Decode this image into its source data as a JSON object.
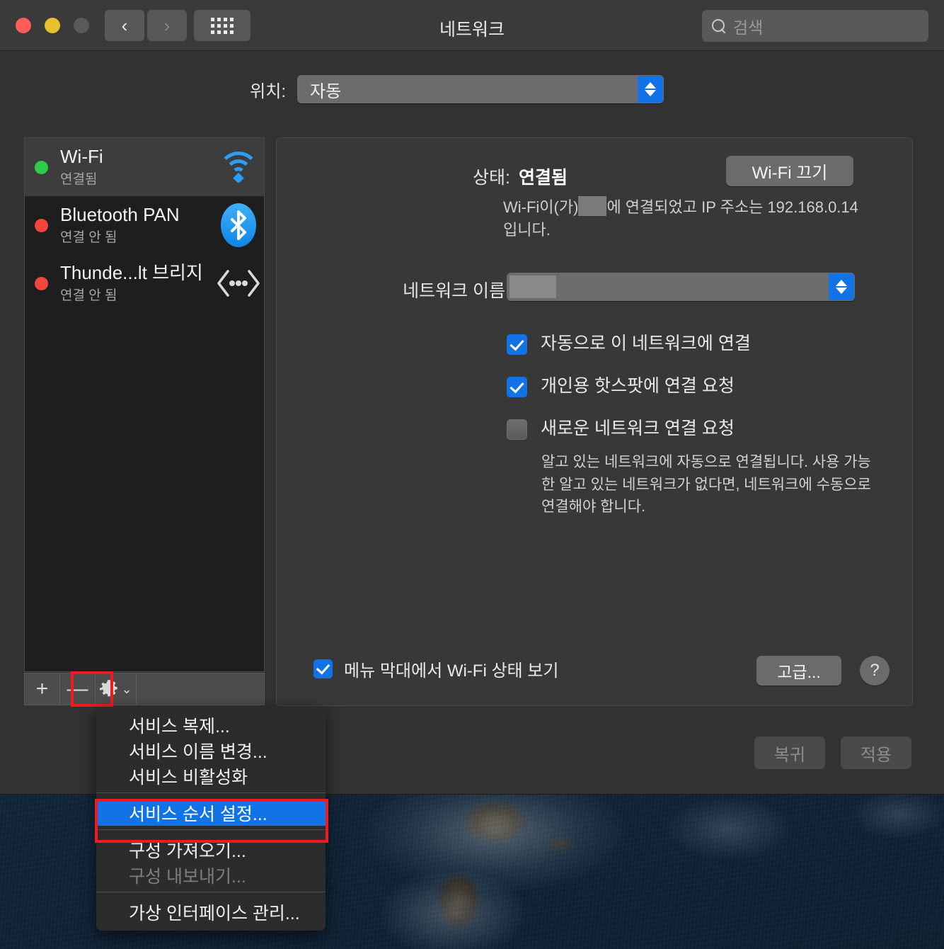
{
  "window": {
    "title": "네트워크",
    "traffic_lights": [
      "close",
      "minimize",
      "zoom"
    ],
    "nav": {
      "back": "‹",
      "forward": "›",
      "grid": "grid-view-icon"
    },
    "search": {
      "placeholder": "검색",
      "value": ""
    }
  },
  "location": {
    "label": "위치:",
    "value": "자동"
  },
  "services": [
    {
      "name": "Wi-Fi",
      "status": "연결됨",
      "dot": "green",
      "icon": "wifi-icon",
      "selected": true
    },
    {
      "name": "Bluetooth PAN",
      "status": "연결 안 됨",
      "dot": "red",
      "icon": "bluetooth-icon",
      "selected": false
    },
    {
      "name": "Thunde...lt 브리지",
      "status": "연결 안 됨",
      "dot": "red",
      "icon": "thunderbolt-bridge-icon",
      "selected": false
    }
  ],
  "sidebar_toolbar": {
    "add": "+",
    "remove": "—",
    "gear": "gear-icon",
    "gear_chevron": "⌄"
  },
  "detail": {
    "status_label": "상태:",
    "status_value": "연결됨",
    "wifi_toggle_label": "Wi-Fi 끄기",
    "status_desc_part1": "Wi-Fi이(가)",
    "status_desc_part2": "에 연결되었고 IP 주소는 192.168.0.14입니다.",
    "netname_label": "네트워크 이름:",
    "netname_value": "",
    "checkboxes": [
      {
        "label": "자동으로 이 네트워크에 연결",
        "checked": true
      },
      {
        "label": "개인용 핫스팟에 연결 요청",
        "checked": true
      },
      {
        "label": "새로운 네트워크 연결 요청",
        "checked": false
      }
    ],
    "help_text": "알고 있는 네트워크에 자동으로 연결됩니다. 사용 가능한 알고 있는 네트워크가 없다면, 네트워크에 수동으로 연결해야 합니다.",
    "menubar_checkbox": {
      "label": "메뉴 막대에서 Wi-Fi 상태 보기",
      "checked": true
    },
    "advanced_label": "고급...",
    "help_label": "?"
  },
  "bottom_actions": [
    {
      "label": "복귀",
      "enabled": false
    },
    {
      "label": "적용",
      "enabled": false
    }
  ],
  "context_menu": [
    {
      "label": "서비스 복제...",
      "state": "normal"
    },
    {
      "label": "서비스 이름 변경...",
      "state": "normal"
    },
    {
      "label": "서비스 비활성화",
      "state": "normal"
    },
    {
      "label": "서비스 순서 설정...",
      "state": "selected"
    },
    {
      "label": "구성 가져오기...",
      "state": "normal"
    },
    {
      "label": "구성 내보내기...",
      "state": "disabled"
    },
    {
      "label": "가상 인터페이스 관리...",
      "state": "normal"
    }
  ],
  "colors": {
    "accent_blue": "#1273e6",
    "highlight_red": "#ee1b23",
    "status_green": "#2fcc4a",
    "status_red": "#f3453b",
    "wifi_blue": "#2e9ef4"
  }
}
